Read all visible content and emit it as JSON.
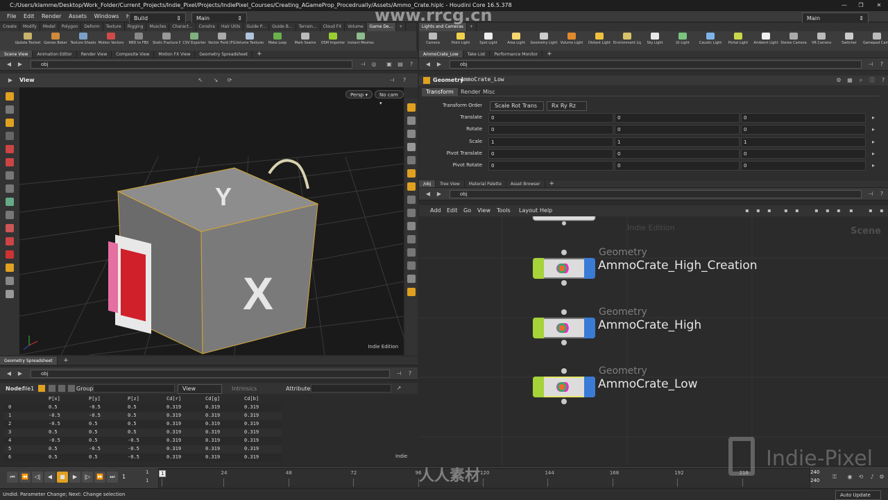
{
  "window": {
    "title": "C:/Users/klamme/Desktop/Work_Folder/Current_Projects/Indie_Pixel/Projects/IndiePixel_Courses/Creating_AGameProp_Procedrually/Assets/Ammo_Crate.hiplc - Houdini Core 16.5.378",
    "controls": [
      "—",
      "❐",
      "✕"
    ]
  },
  "menubar": {
    "items": [
      "File",
      "Edit",
      "Render",
      "Assets",
      "Windows",
      "Help"
    ],
    "build_label": "Build",
    "main_label": "Main",
    "main_right_label": "Main"
  },
  "left_shelf": {
    "tabs": [
      "Create",
      "Modify",
      "Model",
      "Polygon",
      "Deform",
      "Texture",
      "Rigging",
      "Muscles",
      "Charact...",
      "Constra",
      "Hair Utils",
      "Guide P...",
      "Guide B...",
      "Terrain...",
      "Cloud FX",
      "Volume",
      "Game De..."
    ],
    "tools": [
      {
        "label": "Update Toolset",
        "color": "#c9b26b"
      },
      {
        "label": "Games Baker",
        "color": "#d08a3a"
      },
      {
        "label": "Texture Sheets",
        "color": "#7aa0c8"
      },
      {
        "label": "Motion Vectors",
        "color": "#d04a4a"
      },
      {
        "label": "RBD to FBX",
        "color": "#888888"
      },
      {
        "label": "Static Fracture Ex",
        "color": "#999999"
      },
      {
        "label": "CSV Exporter",
        "color": "#7fb07f"
      },
      {
        "label": "Vector Field (FGA)",
        "color": "#aaaaaa"
      },
      {
        "label": "Volume Textures",
        "color": "#b0c4de"
      },
      {
        "label": "Make Loop",
        "color": "#6ab04c"
      },
      {
        "label": "Mark Seams",
        "color": "#bbbbbb"
      },
      {
        "label": "OSM Importer",
        "color": "#9acd32"
      },
      {
        "label": "Instant Meshes",
        "color": "#8fbc8f"
      }
    ]
  },
  "right_shelf": {
    "tabs": [
      "Lights and Cameras"
    ],
    "tools": [
      {
        "label": "Camera",
        "color": "#bbbbbb"
      },
      {
        "label": "Point Light",
        "color": "#f1d04b"
      },
      {
        "label": "Spot Light",
        "color": "#eeeeee"
      },
      {
        "label": "Area Light",
        "color": "#f5d76e"
      },
      {
        "label": "Geometry Light",
        "color": "#cccccc"
      },
      {
        "label": "Volume Light",
        "color": "#e08a2e"
      },
      {
        "label": "Distant Light",
        "color": "#f0c040"
      },
      {
        "label": "Environment Light",
        "color": "#d6c26a"
      },
      {
        "label": "Sky Light",
        "color": "#e8e8e8"
      },
      {
        "label": "GI Light",
        "color": "#7bc47f"
      },
      {
        "label": "Caustic Light",
        "color": "#7fb4e8"
      },
      {
        "label": "Portal Light",
        "color": "#c8d84a"
      },
      {
        "label": "Ambient Light",
        "color": "#f0f0f0"
      },
      {
        "label": "Stereo Camera",
        "color": "#aaaaaa"
      },
      {
        "label": "VR Camera",
        "color": "#bbbbbb"
      },
      {
        "label": "Switcher",
        "color": "#cccccc"
      },
      {
        "label": "Gamepad Camera",
        "color": "#bbbbbb"
      }
    ]
  },
  "scene_tabs": [
    "Scene View",
    "Animation Editor",
    "Render View",
    "Composite View",
    "Motion FX View",
    "Geometry Spreadsheet"
  ],
  "scene_path": "obj",
  "viewport": {
    "label": "View",
    "persp_label": "Persp ▾",
    "cam_label": "No cam ▾",
    "edition_label": "Indie Edition",
    "face_top": "Y",
    "face_right": "X"
  },
  "spreadsheet": {
    "tab": "Geometry Spreadsheet",
    "path": "obj",
    "node_label": "Node:",
    "node_value": "file1",
    "group_label": "Group:",
    "view_label": "View",
    "intrinsics_label": "Intrinsics",
    "attributes_label": "Attributes:",
    "columns": [
      "",
      "P[x]",
      "P[y]",
      "P[z]",
      "Cd[r]",
      "Cd[g]",
      "Cd[b]"
    ],
    "rows": [
      [
        "0",
        "0.5",
        "-0.5",
        "0.5",
        "0.319",
        "0.319",
        "0.319"
      ],
      [
        "1",
        "-0.5",
        "-0.5",
        "0.5",
        "0.319",
        "0.319",
        "0.319"
      ],
      [
        "2",
        "-0.5",
        "0.5",
        "0.5",
        "0.319",
        "0.319",
        "0.319"
      ],
      [
        "3",
        "0.5",
        "0.5",
        "0.5",
        "0.319",
        "0.319",
        "0.319"
      ],
      [
        "4",
        "-0.5",
        "0.5",
        "-0.5",
        "0.319",
        "0.319",
        "0.319"
      ],
      [
        "5",
        "0.5",
        "-0.5",
        "-0.5",
        "0.319",
        "0.319",
        "0.319"
      ],
      [
        "6",
        "0.5",
        "0.5",
        "-0.5",
        "0.319",
        "0.319",
        "0.319"
      ]
    ],
    "edition_label": "Indie"
  },
  "param_tabs": [
    "AmmoCrate_Low",
    "Take List",
    "Performance Monitor"
  ],
  "param_path": "obj",
  "params": {
    "op_type": "Geometry",
    "op_name": "AmmoCrate_Low",
    "subtabs": [
      "Transform",
      "Render",
      "Misc"
    ],
    "transform_order_label": "Transform Order",
    "transform_order_value": "Scale Rot Trans",
    "rot_order_value": "Rx Ry Rz",
    "rows": [
      {
        "label": "Translate",
        "values": [
          "0",
          "0",
          "0"
        ]
      },
      {
        "label": "Rotate",
        "values": [
          "0",
          "0",
          "0"
        ]
      },
      {
        "label": "Scale",
        "values": [
          "1",
          "1",
          "1"
        ]
      },
      {
        "label": "Pivot Translate",
        "values": [
          "0",
          "0",
          "0"
        ]
      },
      {
        "label": "Pivot Rotate",
        "values": [
          "0",
          "0",
          "0"
        ]
      }
    ]
  },
  "network_tabs": [
    "/obj",
    "Tree View",
    "Material Palette",
    "Asset Browser"
  ],
  "network_path": "obj",
  "network_menu": [
    "Add",
    "Edit",
    "Go",
    "View",
    "Tools",
    "Layout",
    "Help"
  ],
  "network": {
    "edition_label": "Indie Edition",
    "context_label": "Scene",
    "nodes": [
      {
        "type": "Geometry",
        "name": "AmmoCrate_High_Creation"
      },
      {
        "type": "Geometry",
        "name": "AmmoCrate_High"
      },
      {
        "type": "Geometry",
        "name": "AmmoCrate_Low"
      }
    ]
  },
  "timeline": {
    "frame": "1",
    "start": "1",
    "end_start": "1",
    "ticks": [
      "1",
      "24",
      "48",
      "72",
      "96",
      "120",
      "144",
      "168",
      "192",
      "216"
    ],
    "end": "240",
    "end2": "240",
    "buttons": [
      "⏮",
      "⏪",
      "◁|",
      "◀",
      "■",
      "▶",
      "|▷",
      "⏩",
      "⏭"
    ]
  },
  "statusbar": {
    "message": "Undid: Parameter Change; Next: Change selection",
    "auto_update": "Auto Update"
  },
  "watermarks": {
    "site": "www.rrcg.cn",
    "brand": "Indie-Pixel",
    "cn": "人人素材"
  },
  "colors": {
    "node_left": "#a6d23a",
    "node_right": "#3a7bd5",
    "selected_node_border": "#e9e66b",
    "accent_tool": "#e0a020"
  }
}
